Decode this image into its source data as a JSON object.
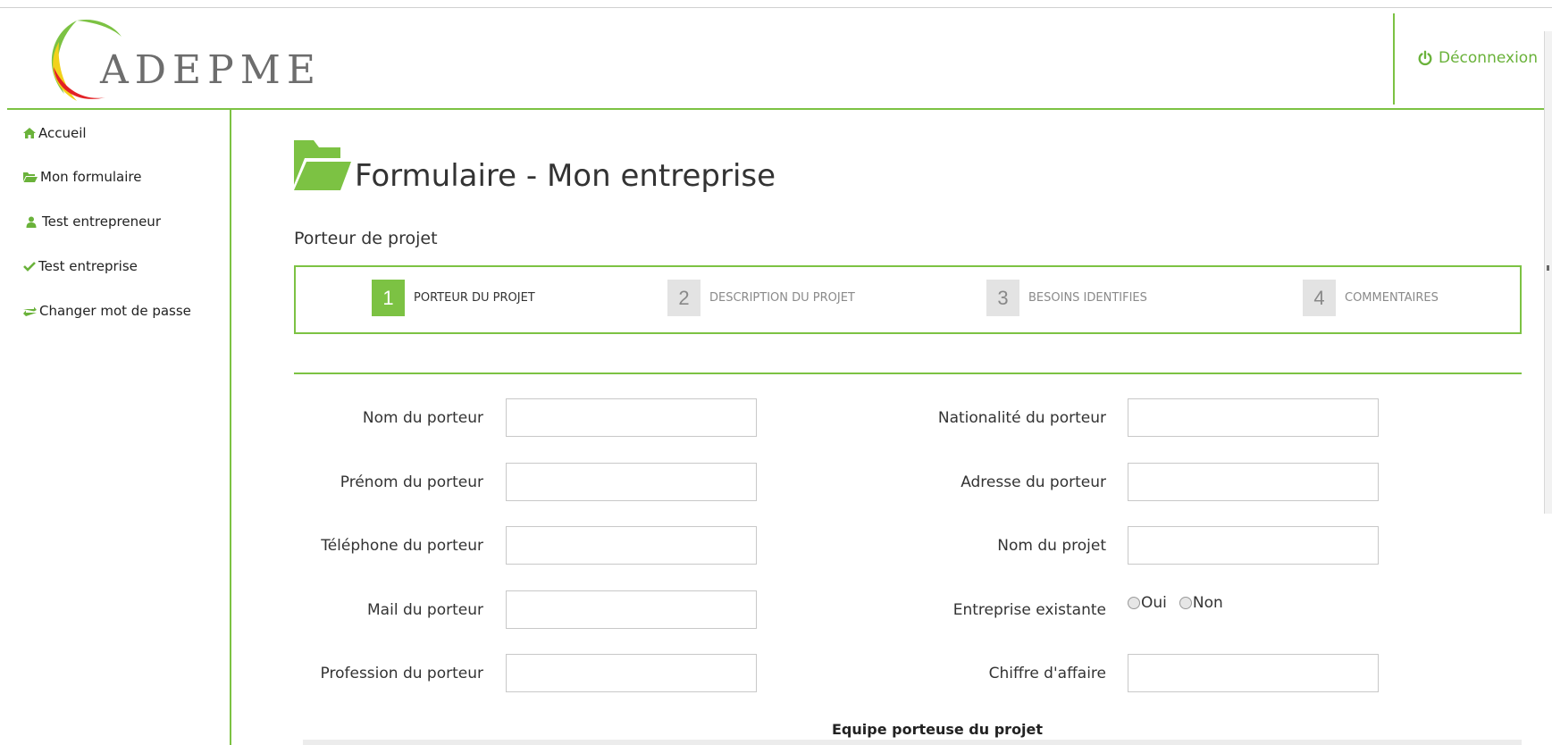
{
  "header": {
    "logo_text": "ADEPME",
    "logout_label": "Déconnexion"
  },
  "sidebar": {
    "items": [
      {
        "label": "Accueil",
        "icon": "home-icon"
      },
      {
        "label": "Mon formulaire",
        "icon": "folder-open-icon"
      },
      {
        "label": "Test entrepreneur",
        "icon": "user-icon"
      },
      {
        "label": "Test entreprise",
        "icon": "check-icon"
      },
      {
        "label": "Changer mot de passe",
        "icon": "swap-icon"
      }
    ]
  },
  "main": {
    "title": "Formulaire - Mon entreprise",
    "section_title": "Porteur de projet",
    "steps": [
      {
        "number": "1",
        "label": "PORTEUR DU PROJET",
        "active": true
      },
      {
        "number": "2",
        "label": "DESCRIPTION DU PROJET",
        "active": false
      },
      {
        "number": "3",
        "label": "BESOINS IDENTIFIES",
        "active": false
      },
      {
        "number": "4",
        "label": "COMMENTAIRES",
        "active": false
      }
    ],
    "fields_left": [
      {
        "label": "Nom du porteur",
        "value": ""
      },
      {
        "label": "Prénom du porteur",
        "value": ""
      },
      {
        "label": "Téléphone du porteur",
        "value": ""
      },
      {
        "label": "Mail du porteur",
        "value": ""
      },
      {
        "label": "Profession du porteur",
        "value": ""
      }
    ],
    "fields_right": [
      {
        "label": "Nationalité du porteur",
        "value": ""
      },
      {
        "label": "Adresse du porteur",
        "value": ""
      },
      {
        "label": "Nom du projet",
        "value": ""
      },
      {
        "label": "Entreprise existante",
        "value": ""
      },
      {
        "label": "Chiffre d'affaire",
        "value": ""
      }
    ],
    "existing_company_options": [
      "Oui",
      "Non"
    ],
    "team_title": "Equipe porteuse du projet"
  },
  "colors": {
    "accent": "#7cc243",
    "accent_text": "#6ab23a",
    "step_inactive": "#e3e3e3"
  }
}
